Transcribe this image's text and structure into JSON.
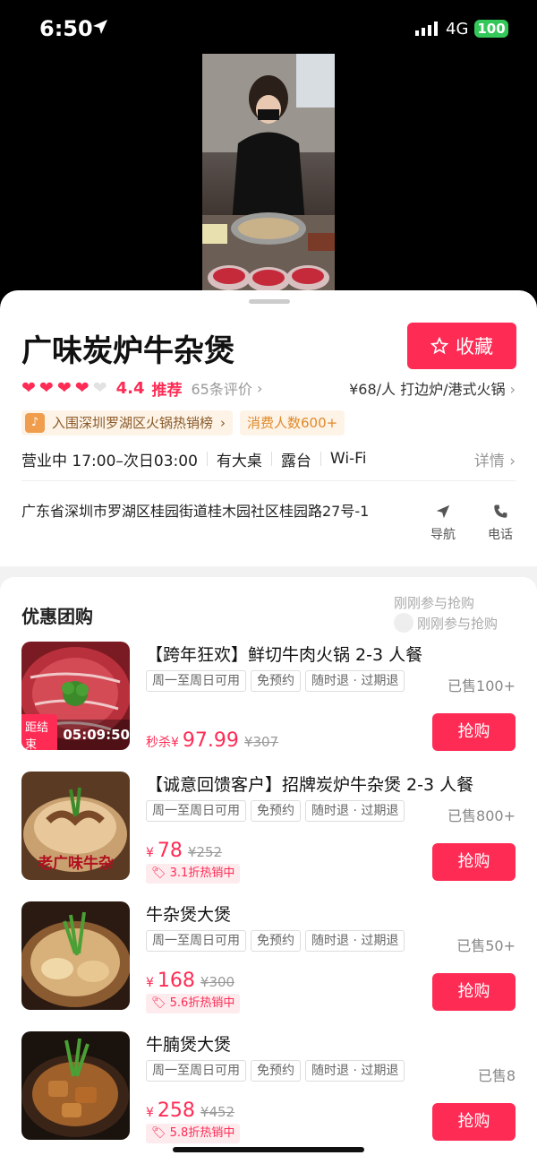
{
  "status_bar": {
    "time": "6:50",
    "network": "4G",
    "battery": "100"
  },
  "shop": {
    "name": "广味炭炉牛杂煲",
    "favorite_label": "收藏",
    "rating": "4.4",
    "rating_tag": "推荐",
    "reviews": "65条评价",
    "price_category": "¥68/人   打边炉/港式火锅",
    "rank_badge": "入围深圳罗湖区火锅热销榜",
    "consumer_badge": "消费人数600+",
    "hours": [
      "营业中 17:00–次日03:00",
      "有大桌",
      "露台",
      "Wi-Fi"
    ],
    "details_label": "详情",
    "address": "广东省深圳市罗湖区桂园街道桂木园社区桂园路27号-1",
    "nav_label": "导航",
    "call_label": "电话"
  },
  "deals": {
    "title": "优惠团购",
    "bubble1": "刚刚参与抢购",
    "bubble2": "刚刚参与抢购",
    "items": [
      {
        "name": "【跨年狂欢】鲜切牛肉火锅 2-3 人餐",
        "tags": [
          "周一至周日可用",
          "免预约",
          "随时退 · 过期退"
        ],
        "sold": "已售100+",
        "price_prefix": "秒杀¥",
        "price": "97.99",
        "old_price": "¥307",
        "countdown_label": "距结束",
        "countdown": "05:09:50",
        "buy_label": "抢购"
      },
      {
        "name": "【诚意回馈客户】招牌炭炉牛杂煲 2-3 人餐",
        "tags": [
          "周一至周日可用",
          "免预约",
          "随时退 · 过期退"
        ],
        "sold": "已售800+",
        "price_prefix": "¥",
        "price": "78",
        "old_price": "¥252",
        "discount": "3.1折热销中",
        "thumb_text": "老广味牛杂",
        "buy_label": "抢购"
      },
      {
        "name": "牛杂煲大煲",
        "tags": [
          "周一至周日可用",
          "免预约",
          "随时退 · 过期退"
        ],
        "sold": "已售50+",
        "price_prefix": "¥",
        "price": "168",
        "old_price": "¥300",
        "discount": "5.6折热销中",
        "buy_label": "抢购"
      },
      {
        "name": "牛腩煲大煲",
        "tags": [
          "周一至周日可用",
          "免预约",
          "随时退 · 过期退"
        ],
        "sold": "已售8",
        "price_prefix": "¥",
        "price": "258",
        "old_price": "¥452",
        "discount": "5.8折热销中",
        "buy_label": "抢购"
      }
    ]
  }
}
